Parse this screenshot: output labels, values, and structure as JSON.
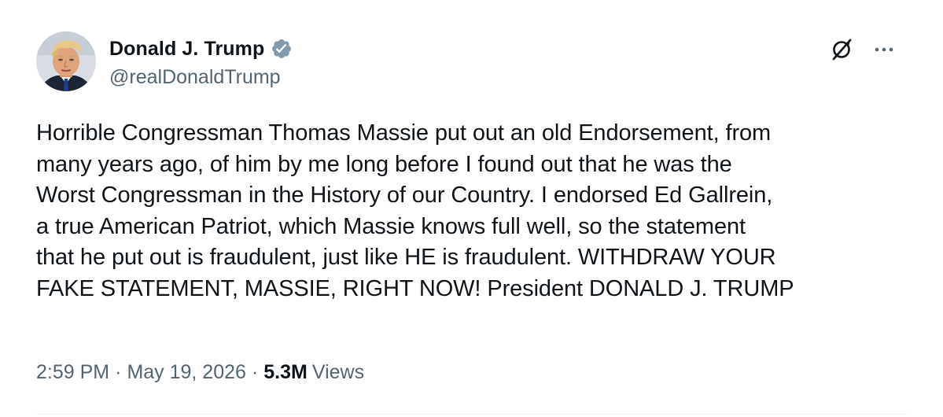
{
  "author": {
    "display_name": "Donald J. Trump",
    "handle": "@realDonaldTrump",
    "verified": true,
    "verified_badge_color": "#829aab",
    "avatar_icon": "profile-photo"
  },
  "actions": {
    "grok_icon": "grok-icon",
    "more_icon": "more-horizontal-icon"
  },
  "post": {
    "text": "Horrible Congressman Thomas Massie put out an old Endorsement, from\nmany years ago, of him by me long before I found out that he was the\nWorst Congressman in the History of our Country. I endorsed Ed Gallrein,\na true American Patriot, which Massie knows full well, so the statement\nthat he put out is fraudulent, just like HE is fraudulent. WITHDRAW YOUR\nFAKE STATEMENT, MASSIE, RIGHT NOW! President DONALD J. TRUMP"
  },
  "meta": {
    "time": "2:59 PM",
    "separator": "·",
    "date": "May 19, 2026",
    "views_count": "5.3M",
    "views_label": "Views"
  },
  "colors": {
    "text_primary": "#0f1419",
    "text_secondary": "#536471",
    "background": "#ffffff"
  }
}
